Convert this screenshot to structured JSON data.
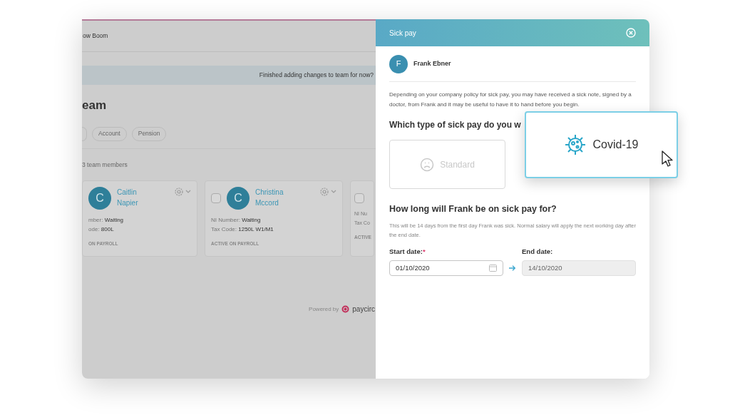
{
  "team_page": {
    "header_title": "ow Boom",
    "banner": "Finished adding changes to team for now?",
    "heading": "eam",
    "filters": [
      "Account",
      "Pension"
    ],
    "count": "3 team members",
    "members": [
      {
        "initial": "C",
        "name": [
          "Caitlin",
          "Napier"
        ],
        "ni_label": "mber:",
        "ni_value": "Waiting",
        "tax_label": "ode:",
        "tax_value": "800L",
        "status": "ON PAYROLL"
      },
      {
        "initial": "C",
        "checked": false,
        "name": [
          "Christina",
          "Mccord"
        ],
        "ni_label": "NI Number:",
        "ni_value": "Waiting",
        "tax_label": "Tax Code:",
        "tax_value": "1250L W1/M1",
        "status": "ACTIVE ON PAYROLL"
      },
      {
        "checked": false,
        "ni_label": "NI Nu",
        "tax_label": "Tax Co",
        "status": "ACTIVE"
      }
    ],
    "powered_by": "Powered by",
    "logo": "paycirc"
  },
  "sick_pay_panel": {
    "title": "Sick pay",
    "employee": {
      "initial": "F",
      "name": "Frank Ebner"
    },
    "intro": "Depending on your company policy for sick pay, you may have received a sick note, signed by a doctor, from Frank and it may be useful to have it to hand before you begin.",
    "question_type": "Which type of sick pay do you w",
    "options": [
      {
        "kind": "standard",
        "label": "Standard",
        "selected": false
      },
      {
        "kind": "covid",
        "label": "Covid-19",
        "selected": true
      }
    ],
    "question_duration": "How long will Frank be on sick pay for?",
    "note": "This will be 14 days from the first day Frank was sick. Normal salary will apply the next working day after the end date.",
    "start": {
      "label": "Start date:",
      "required_mark": "*",
      "value": "01/10/2020",
      "disabled": false
    },
    "end": {
      "label": "End date:",
      "value": "14/10/2020",
      "disabled": true
    }
  }
}
